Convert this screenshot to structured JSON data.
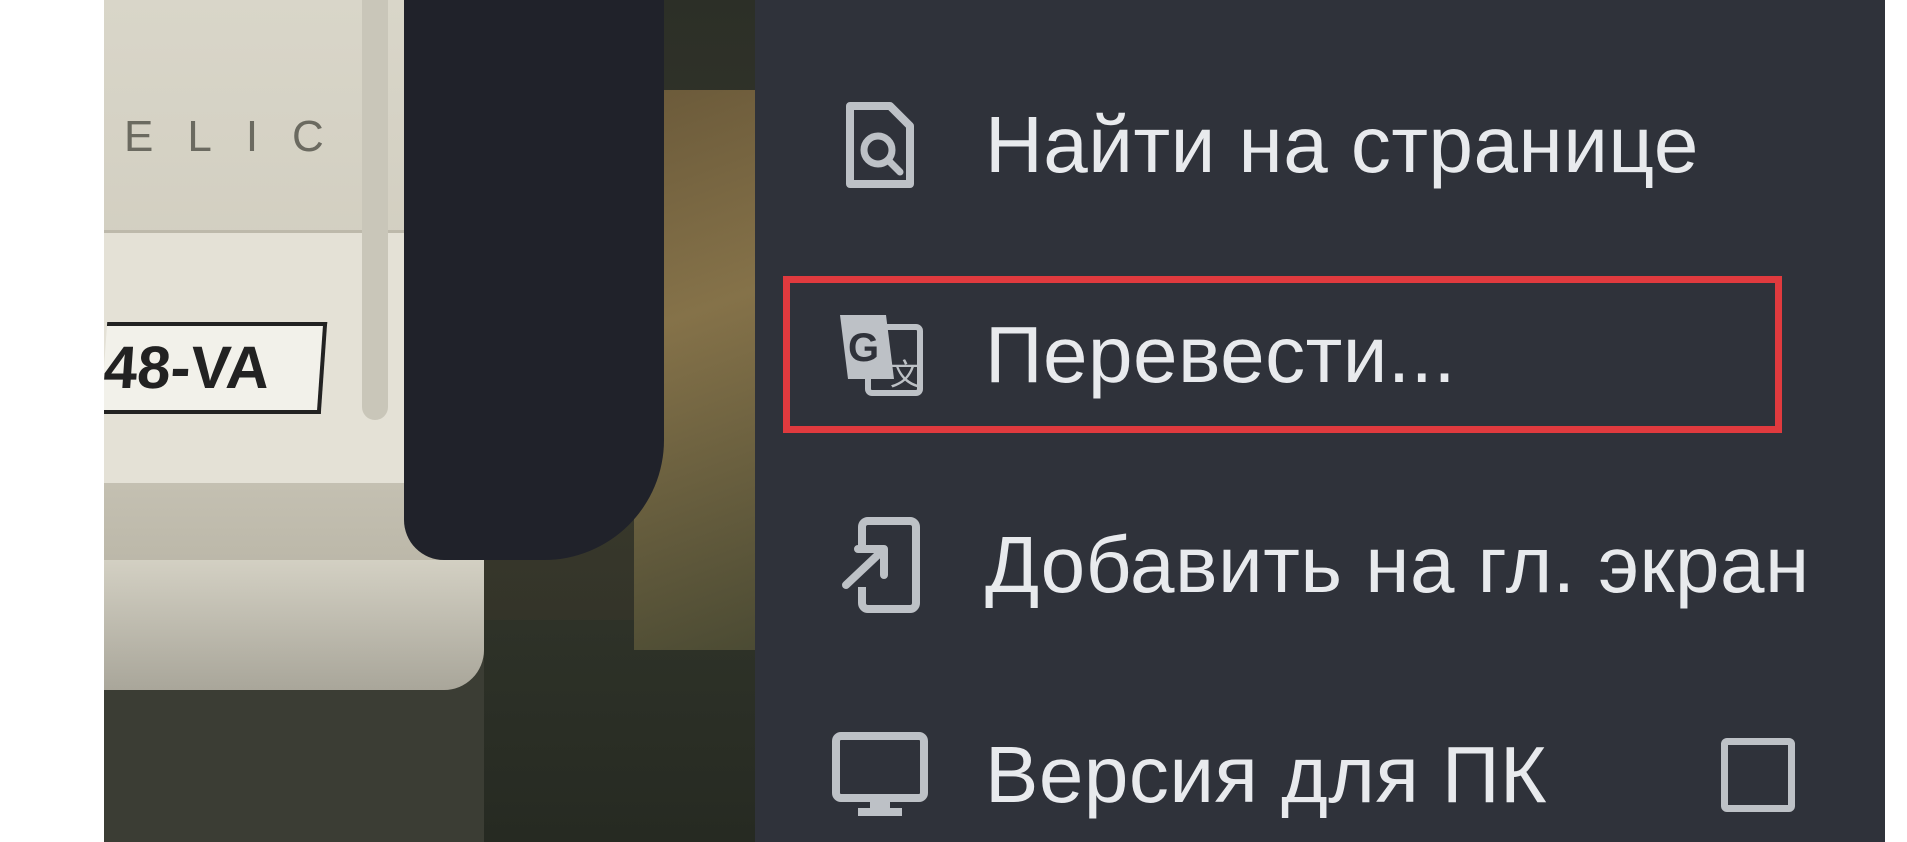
{
  "background_page": {
    "van_lettering": "ELIC",
    "plate_text": "48-VA"
  },
  "menu": {
    "items": [
      {
        "label": "Найти на странице",
        "icon": "find-in-page-icon"
      },
      {
        "label": "Перевести...",
        "icon": "google-translate-icon",
        "highlighted": true
      },
      {
        "label": "Добавить на гл. экран",
        "icon": "add-to-home-screen-icon"
      },
      {
        "label": "Версия для ПК",
        "icon": "desktop-icon",
        "checkbox_checked": false
      }
    ]
  },
  "colors": {
    "menu_background": "#2f323a",
    "menu_text": "#e8eaed",
    "icon_color": "#bdc1c6",
    "highlight": "#e03a3e"
  }
}
